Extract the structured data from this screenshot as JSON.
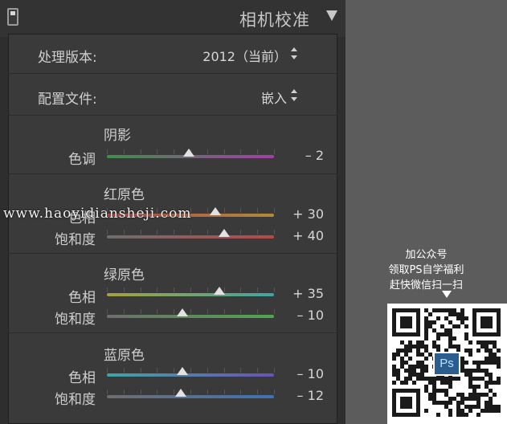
{
  "panel": {
    "title": "相机校准",
    "processing_version": {
      "label": "处理版本:",
      "value": "2012（当前）"
    },
    "profile": {
      "label": "配置文件:",
      "value": "嵌入"
    },
    "shadows": {
      "title": "阴影",
      "sliders": [
        {
          "label": "色调",
          "value": "– 2",
          "level": -2,
          "gradient": [
            "#3f8e4a",
            "#a33ea8"
          ]
        }
      ]
    },
    "red_primary": {
      "title": "红原色",
      "sliders": [
        {
          "label": "色相",
          "value": "+ 30",
          "level": 30,
          "gradient": [
            "#b0474f",
            "#b08a3a"
          ]
        },
        {
          "label": "饱和度",
          "value": "+ 40",
          "level": 40,
          "gradient": [
            "#6e6e6e",
            "#b84848"
          ]
        }
      ]
    },
    "green_primary": {
      "title": "绿原色",
      "sliders": [
        {
          "label": "色相",
          "value": "+ 35",
          "level": 35,
          "gradient": [
            "#a4a23c",
            "#3fa5a2"
          ]
        },
        {
          "label": "饱和度",
          "value": "– 10",
          "level": -10,
          "gradient": [
            "#6e6e6e",
            "#4ea64e"
          ]
        }
      ]
    },
    "blue_primary": {
      "title": "蓝原色",
      "sliders": [
        {
          "label": "色相",
          "value": "– 10",
          "level": -10,
          "gradient": [
            "#3ea6a6",
            "#6a52b4"
          ]
        },
        {
          "label": "饱和度",
          "value": "– 12",
          "level": -12,
          "gradient": [
            "#6e6e6e",
            "#3f72b4"
          ]
        }
      ]
    },
    "slider_range": [
      -100,
      100
    ]
  },
  "watermark": "www.haoyidiansheji.com",
  "promo": {
    "lines": [
      "加公众号",
      "领取PS自学福利",
      "赶快微信扫一扫"
    ],
    "qr_badge": "Ps"
  }
}
